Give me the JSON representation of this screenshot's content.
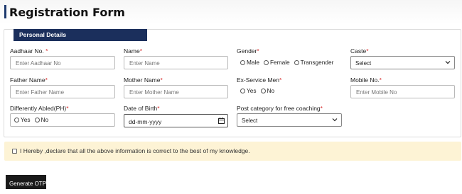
{
  "page": {
    "title": "Registration Form"
  },
  "section": {
    "legend": "Personal Details"
  },
  "fields": {
    "aadhaar": {
      "label": "Aadhaar No.",
      "required": "*",
      "placeholder": "Enter Aadhaar No"
    },
    "name": {
      "label": "Name",
      "required": "*",
      "placeholder": "Enter Name"
    },
    "gender": {
      "label": "Gender",
      "required": "*",
      "options": [
        "Male",
        "Female",
        "Transgender"
      ]
    },
    "caste": {
      "label": "Caste",
      "required": "*",
      "selected": "Select"
    },
    "father_name": {
      "label": "Father Name",
      "required": "*",
      "placeholder": "Enter Father Name"
    },
    "mother_name": {
      "label": "Mother Name",
      "required": "*",
      "placeholder": "Enter Mother Name"
    },
    "ex_service": {
      "label": "Ex-Service Men",
      "required": "*",
      "options": [
        "Yes",
        "No"
      ]
    },
    "mobile": {
      "label": "Mobile No.",
      "required": "*",
      "placeholder": "Enter Mobile No"
    },
    "differently_abled": {
      "label": "Differently Abled(PH)",
      "required": "*",
      "options": [
        "Yes",
        "No"
      ]
    },
    "dob": {
      "label": "Date of Birth",
      "required": "*",
      "value": "dd-mm-yyyy"
    },
    "post_category": {
      "label": "Post category for free coaching",
      "required": "*",
      "selected": "Select"
    }
  },
  "declaration": {
    "text": "I Hereby ,declare that all the above information is correct to the best of my knowledge."
  },
  "actions": {
    "generate_otp": "Generate OTP"
  },
  "colors": {
    "accent": "#1b2f5c",
    "required": "#d62a2a",
    "notice_bg": "#fdf3d5",
    "button_bg": "#1a1a1a"
  }
}
